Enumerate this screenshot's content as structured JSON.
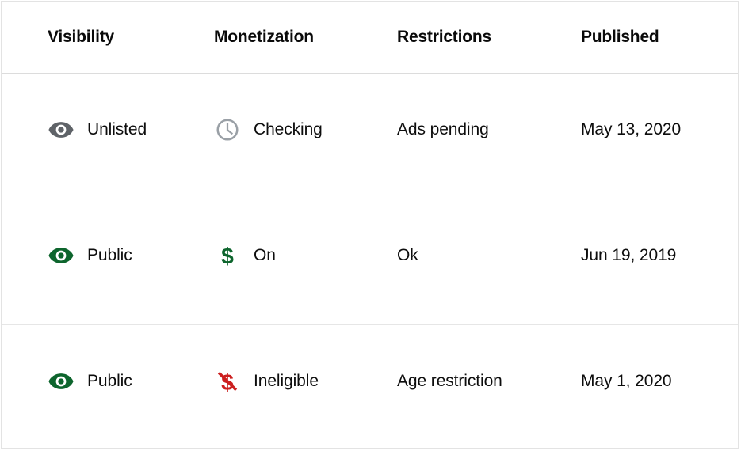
{
  "table": {
    "columns": [
      {
        "key": "visibility",
        "label": "Visibility"
      },
      {
        "key": "monetization",
        "label": "Monetization"
      },
      {
        "key": "restrictions",
        "label": "Restrictions"
      },
      {
        "key": "published",
        "label": "Published"
      }
    ],
    "rows": [
      {
        "visibility": {
          "icon": "eye-icon",
          "icon_color": "#5f6368",
          "label": "Unlisted"
        },
        "monetization": {
          "icon": "clock-icon",
          "icon_color": "#9aa0a6",
          "label": "Checking"
        },
        "restrictions": {
          "label": "Ads pending"
        },
        "published": {
          "label": "May 13, 2020"
        }
      },
      {
        "visibility": {
          "icon": "eye-icon",
          "icon_color": "#0d652d",
          "label": "Public"
        },
        "monetization": {
          "icon": "dollar-sign-icon",
          "icon_color": "#0d652d",
          "label": "On"
        },
        "restrictions": {
          "label": "Ok"
        },
        "published": {
          "label": "Jun 19, 2019"
        }
      },
      {
        "visibility": {
          "icon": "eye-icon",
          "icon_color": "#0d652d",
          "label": "Public"
        },
        "monetization": {
          "icon": "dollar-sign-off-icon",
          "icon_color": "#cc1f1f",
          "label": "Ineligible"
        },
        "restrictions": {
          "label": "Age restriction"
        },
        "published": {
          "label": "May 1, 2020"
        }
      }
    ]
  },
  "colors": {
    "text": "#0d0d0d",
    "header_text": "#0a0a0a",
    "icon_gray": "#5f6368",
    "icon_gray_light": "#9aa0a6",
    "icon_green": "#0d652d",
    "icon_red": "#cc1f1f",
    "border": "#e3e3e3",
    "divider": "#e6e6e6"
  }
}
